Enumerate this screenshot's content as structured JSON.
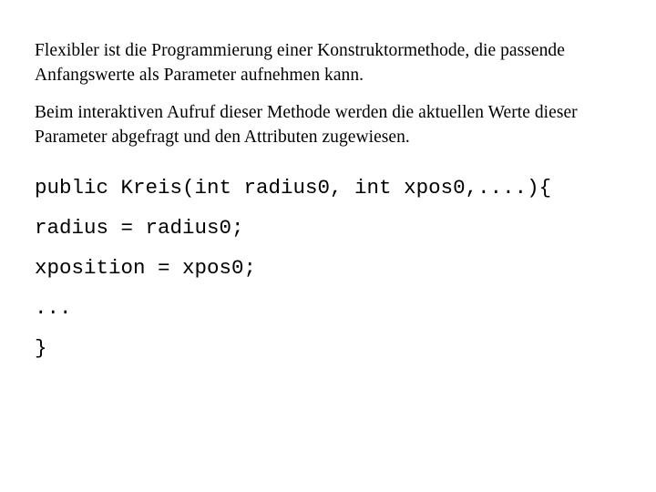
{
  "slide": {
    "background_color": "#ffffff",
    "text_color": "#000000",
    "paragraphs": [
      {
        "id": "intro-paragraph",
        "text": "Flexibler ist die Programmierung einer Konstruktormethode, die passende Anfangswerte als Parameter aufnehmen kann."
      },
      {
        "id": "explanation-paragraph",
        "text": "Beim interaktiven Aufruf dieser Methode werden die aktuellen Werte dieser Parameter abgefragt und den Attributen zugewiesen."
      }
    ],
    "code": {
      "language": "java",
      "lines": [
        "public Kreis(int radius0, int xpos0,....){",
        "radius = radius0;",
        "xposition = xpos0;",
        "...",
        "}"
      ]
    }
  }
}
